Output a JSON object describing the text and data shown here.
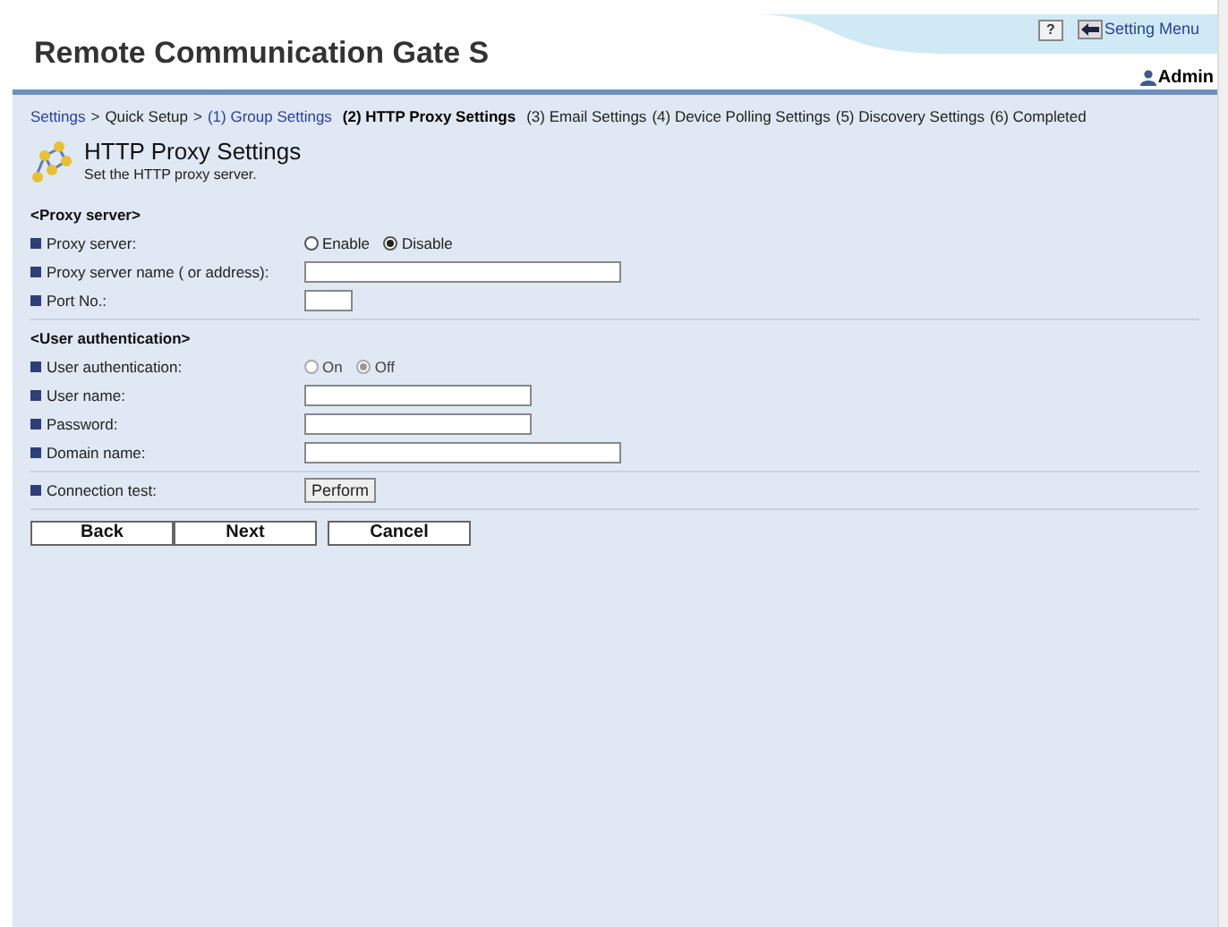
{
  "header": {
    "title": "Remote Communication Gate S",
    "help": "?",
    "setting_menu": "Setting Menu",
    "user": "Admin"
  },
  "breadcrumb": [
    {
      "text": "Settings",
      "kind": "link"
    },
    {
      "text": ">",
      "kind": "sep"
    },
    {
      "text": "Quick Setup",
      "kind": "plain"
    },
    {
      "text": ">",
      "kind": "sep"
    },
    {
      "text": "(1) Group Settings",
      "kind": "link"
    },
    {
      "text": "(2) HTTP Proxy Settings",
      "kind": "current"
    },
    {
      "text": "(3) Email Settings",
      "kind": "plain"
    },
    {
      "text": "(4) Device Polling Settings",
      "kind": "plain"
    },
    {
      "text": "(5) Discovery Settings",
      "kind": "plain"
    },
    {
      "text": "(6) Completed",
      "kind": "plain"
    }
  ],
  "page": {
    "title": "HTTP Proxy Settings",
    "subtitle": "Set the HTTP proxy server."
  },
  "sections": [
    {
      "heading": "<Proxy server>",
      "rows": [
        {
          "kind": "radio",
          "label": "Proxy server:",
          "disabled": false,
          "options": [
            {
              "label": "Enable",
              "selected": false
            },
            {
              "label": "Disable",
              "selected": true
            }
          ]
        },
        {
          "kind": "text",
          "label": "Proxy server name ( or address):"
        },
        {
          "kind": "text",
          "label": "Port No.:"
        }
      ]
    },
    {
      "heading": "<User authentication>",
      "rows": [
        {
          "kind": "radio",
          "label": "User authentication:",
          "disabled": true,
          "options": [
            {
              "label": "On",
              "selected": false
            },
            {
              "label": "Off",
              "selected": true
            }
          ]
        },
        {
          "kind": "text",
          "label": "User name:"
        },
        {
          "kind": "text",
          "label": "Password:"
        },
        {
          "kind": "text",
          "label": "Domain name:"
        }
      ]
    },
    {
      "rows": [
        {
          "kind": "button",
          "label": "Connection test:",
          "button": "Perform"
        }
      ]
    }
  ],
  "buttons": [
    "Back",
    "Next",
    "Cancel"
  ]
}
